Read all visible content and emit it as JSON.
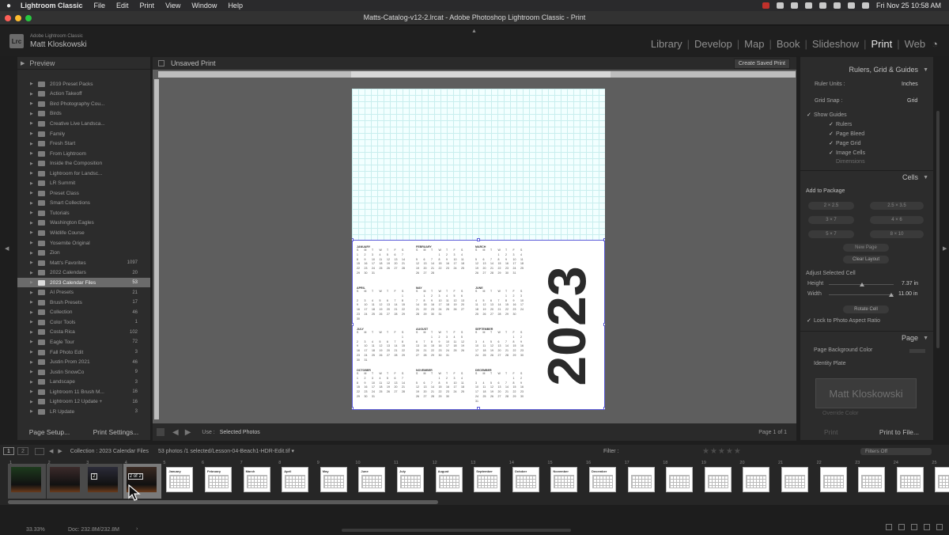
{
  "menubar": {
    "items": [
      "Lightroom Classic",
      "File",
      "Edit",
      "Print",
      "View",
      "Window",
      "Help"
    ],
    "clock": "Fri Nov 25  10:58 AM"
  },
  "window": {
    "title": "Matts-Catalog-v12-2.lrcat - Adobe Photoshop Lightroom Classic - Print"
  },
  "identity": {
    "logo": "Lrc",
    "app": "Adobe Lightroom Classic",
    "user": "Matt Kloskowski"
  },
  "modules": [
    "Library",
    "Develop",
    "Map",
    "Book",
    "Slideshow",
    "Print",
    "Web"
  ],
  "left_panel": {
    "preview_label": "Preview",
    "templates": [
      {
        "name": "2019 Preset Packs",
        "count": ""
      },
      {
        "name": "Action Takeoff",
        "count": ""
      },
      {
        "name": "Bird Photography Cou...",
        "count": ""
      },
      {
        "name": "Birds",
        "count": ""
      },
      {
        "name": "Creative Live Landsca...",
        "count": ""
      },
      {
        "name": "Family",
        "count": ""
      },
      {
        "name": "Fresh Start",
        "count": ""
      },
      {
        "name": "From Lightroom",
        "count": ""
      },
      {
        "name": "Inside the Composition",
        "count": ""
      },
      {
        "name": "Lightroom for Landsc...",
        "count": ""
      },
      {
        "name": "LR Summit",
        "count": ""
      },
      {
        "name": "Preset Class",
        "count": ""
      },
      {
        "name": "Smart Collections",
        "count": ""
      },
      {
        "name": "Tutorials",
        "count": ""
      },
      {
        "name": "Washington Eagles",
        "count": ""
      },
      {
        "name": "Wildlife Course",
        "count": ""
      },
      {
        "name": "Yosemite Original",
        "count": ""
      },
      {
        "name": "Zion",
        "count": ""
      },
      {
        "name": "Matt's Favorites",
        "count": "1097"
      },
      {
        "name": "2022 Calendars",
        "count": "20"
      },
      {
        "name": "2023 Calendar Files",
        "count": "53"
      },
      {
        "name": "AI Presets",
        "count": "21"
      },
      {
        "name": "Brush Presets",
        "count": "17"
      },
      {
        "name": "Collection",
        "count": "46"
      },
      {
        "name": "Color Tools",
        "count": "1"
      },
      {
        "name": "Costa Rica",
        "count": "102"
      },
      {
        "name": "Eagle Tour",
        "count": "72"
      },
      {
        "name": "Fall Photo Edit",
        "count": "3"
      },
      {
        "name": "Justin Prom 2021",
        "count": "46"
      },
      {
        "name": "Justin SnowCo",
        "count": "9"
      },
      {
        "name": "Landscape",
        "count": "3"
      },
      {
        "name": "Lightroom 11 Brush M...",
        "count": "16"
      },
      {
        "name": "Lightroom 12 Update  +",
        "count": "16"
      },
      {
        "name": "LR Update",
        "count": "3"
      }
    ],
    "selected_template": "2023 Calendar Files",
    "page_setup": "Page Setup...",
    "print_settings": "Print Settings..."
  },
  "center": {
    "print_name": "Unsaved Print",
    "create_saved": "Create Saved Print",
    "use_label": "Use :",
    "use_value": "Selected Photos",
    "page_of": "Page 1 of 1"
  },
  "calendar": {
    "year": "2023",
    "weekday_letters": [
      "S",
      "M",
      "T",
      "W",
      "T",
      "F",
      "S"
    ],
    "months": [
      {
        "name": "JANUARY",
        "start": 0,
        "days": 31
      },
      {
        "name": "FEBRUARY",
        "start": 3,
        "days": 28
      },
      {
        "name": "MARCH",
        "start": 3,
        "days": 31
      },
      {
        "name": "APRIL",
        "start": 6,
        "days": 30
      },
      {
        "name": "MAY",
        "start": 1,
        "days": 31
      },
      {
        "name": "JUNE",
        "start": 4,
        "days": 30
      },
      {
        "name": "JULY",
        "start": 6,
        "days": 31
      },
      {
        "name": "AUGUST",
        "start": 2,
        "days": 31
      },
      {
        "name": "SEPTEMBER",
        "start": 5,
        "days": 30
      },
      {
        "name": "OCTOBER",
        "start": 0,
        "days": 31
      },
      {
        "name": "NOVEMBER",
        "start": 3,
        "days": 30
      },
      {
        "name": "DECEMBER",
        "start": 5,
        "days": 31
      }
    ]
  },
  "right_panel": {
    "rulers_title": "Rulers, Grid & Guides",
    "ruler_units_label": "Ruler Units :",
    "ruler_units_value": "Inches",
    "grid_snap_label": "Grid Snap :",
    "grid_snap_value": "Grid",
    "show_guides": "Show Guides",
    "guides": [
      "Rulers",
      "Page Bleed",
      "Page Grid",
      "Image Cells",
      "Dimensions"
    ],
    "cells_title": "Cells",
    "add_to_package": "Add to Package",
    "sizes": [
      "2 × 2.5",
      "2.5 × 3.5",
      "3 × 7",
      "4 × 6",
      "5 × 7",
      "8 × 10"
    ],
    "new_page": "New Page",
    "clear_layout": "Clear Layout",
    "adjust_cell": "Adjust Selected Cell",
    "height_label": "Height",
    "height_value": "7.37",
    "width_label": "Width",
    "width_value": "11.00",
    "unit": "in",
    "rotate_cell": "Rotate Cell",
    "lock_aspect": "Lock to Photo Aspect Ratio",
    "page_title": "Page",
    "page_bg": "Page Background Color",
    "identity_plate": "Identity Plate",
    "plate_text": "Matt Kloskowski",
    "override_color": "Override Color",
    "print_btn": "Print",
    "print_to_file": "Print to File..."
  },
  "filmstrip": {
    "source": "Collection : 2023 Calendar Files",
    "count": "53 photos /1 selected",
    "file": "/Lesson-04-Beach1-HDR-Edit.tif ▾",
    "filter_label": "Filter :",
    "filters_off": "Filters Off",
    "pages": [
      "1",
      "2"
    ],
    "thumbnails": [
      {
        "num": "1",
        "kind": "photo",
        "label": ""
      },
      {
        "num": "2",
        "kind": "photo",
        "label": ""
      },
      {
        "num": "3",
        "kind": "photo",
        "label": "2"
      },
      {
        "num": "4",
        "kind": "photo",
        "label": "2 of 2"
      },
      {
        "num": "5",
        "kind": "page",
        "label": "January"
      },
      {
        "num": "6",
        "kind": "page",
        "label": "February"
      },
      {
        "num": "7",
        "kind": "page",
        "label": "March"
      },
      {
        "num": "8",
        "kind": "page",
        "label": "April"
      },
      {
        "num": "9",
        "kind": "page",
        "label": "May"
      },
      {
        "num": "10",
        "kind": "page",
        "label": "June"
      },
      {
        "num": "11",
        "kind": "page",
        "label": "July"
      },
      {
        "num": "12",
        "kind": "page",
        "label": "August"
      },
      {
        "num": "13",
        "kind": "page",
        "label": "September"
      },
      {
        "num": "14",
        "kind": "page",
        "label": "October"
      },
      {
        "num": "15",
        "kind": "page",
        "label": "November"
      },
      {
        "num": "16",
        "kind": "page",
        "label": "December"
      },
      {
        "num": "17",
        "kind": "page",
        "label": ""
      },
      {
        "num": "18",
        "kind": "page",
        "label": ""
      },
      {
        "num": "19",
        "kind": "page",
        "label": ""
      },
      {
        "num": "20",
        "kind": "page",
        "label": ""
      },
      {
        "num": "21",
        "kind": "page",
        "label": ""
      },
      {
        "num": "22",
        "kind": "page",
        "label": ""
      },
      {
        "num": "23",
        "kind": "page",
        "label": ""
      },
      {
        "num": "24",
        "kind": "page",
        "label": ""
      },
      {
        "num": "25",
        "kind": "page",
        "label": ""
      }
    ]
  },
  "status": {
    "zoom": "33.33%",
    "doc": "Doc: 232.8M/232.8M"
  }
}
